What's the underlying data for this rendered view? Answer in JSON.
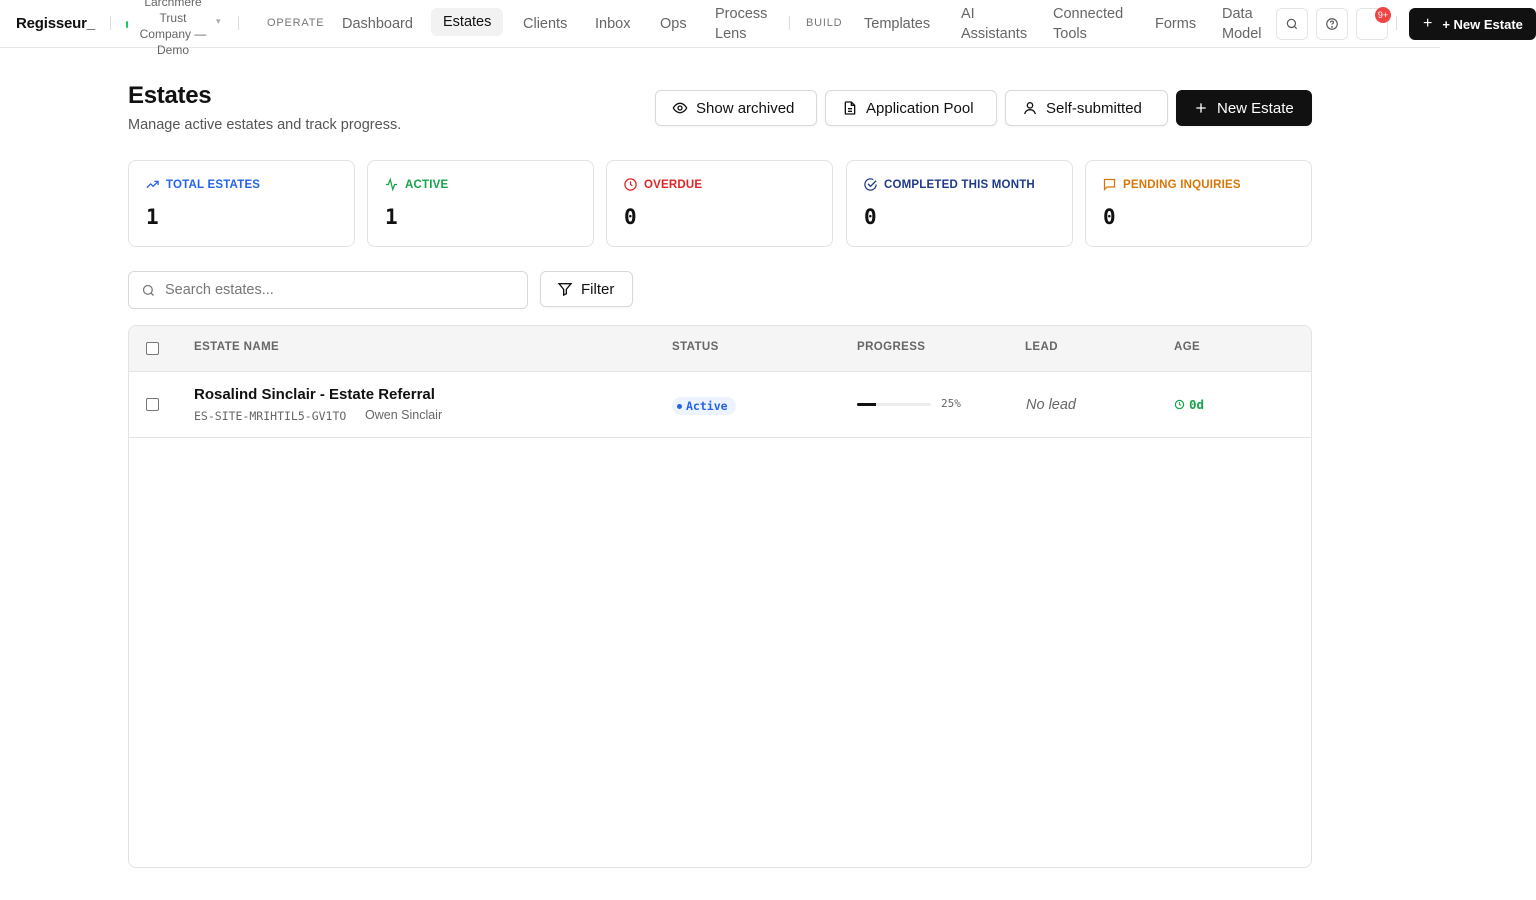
{
  "app": {
    "brand": "Regisseur_",
    "org": "Larchmere Trust Company — Demo"
  },
  "nav": {
    "operate_label": "OPERATE",
    "build_label": "BUILD",
    "operate_items": [
      "Dashboard",
      "Estates",
      "Clients",
      "Inbox",
      "Ops",
      "Process Lens"
    ],
    "build_items": [
      "Templates",
      "AI Assistants",
      "Connected Tools",
      "Forms",
      "Data Model"
    ],
    "active": "Estates",
    "notification_count": "9+",
    "new_estate_label": "+ New Estate",
    "icons": [
      "search-icon",
      "help-icon",
      "bell-icon"
    ]
  },
  "header": {
    "title": "Estates",
    "subtitle": "Manage active estates and track progress.",
    "show_archived_label": "Show archived",
    "application_pool_label": "Application Pool",
    "self_submitted_label": "Self-submitted",
    "new_estate_label": "New Estate"
  },
  "stats": [
    {
      "label": "TOTAL ESTATES",
      "value": "1",
      "color": "#2563eb",
      "icon": "trending-up-icon"
    },
    {
      "label": "ACTIVE",
      "value": "1",
      "color": "#16a34a",
      "icon": "activity-icon"
    },
    {
      "label": "OVERDUE",
      "value": "0",
      "color": "#dc2626",
      "icon": "clock-icon"
    },
    {
      "label": "COMPLETED THIS MONTH",
      "value": "0",
      "color": "#1e3a8a",
      "icon": "check-circle-icon"
    },
    {
      "label": "PENDING INQUIRIES",
      "value": "0",
      "color": "#d97706",
      "icon": "message-icon"
    }
  ],
  "search": {
    "placeholder": "Search estates...",
    "filter_label": "Filter"
  },
  "table": {
    "columns": [
      "ESTATE NAME",
      "STATUS",
      "PROGRESS",
      "LEAD",
      "AGE"
    ],
    "rows": [
      {
        "name": "Rosalind Sinclair - Estate Referral",
        "id": "ES-SITE-MRIHTIL5-GV1TO",
        "client": "Owen Sinclair",
        "status": "Active",
        "progress": 25,
        "progress_label": "25%",
        "lead": "No lead",
        "age": "0d"
      }
    ]
  }
}
